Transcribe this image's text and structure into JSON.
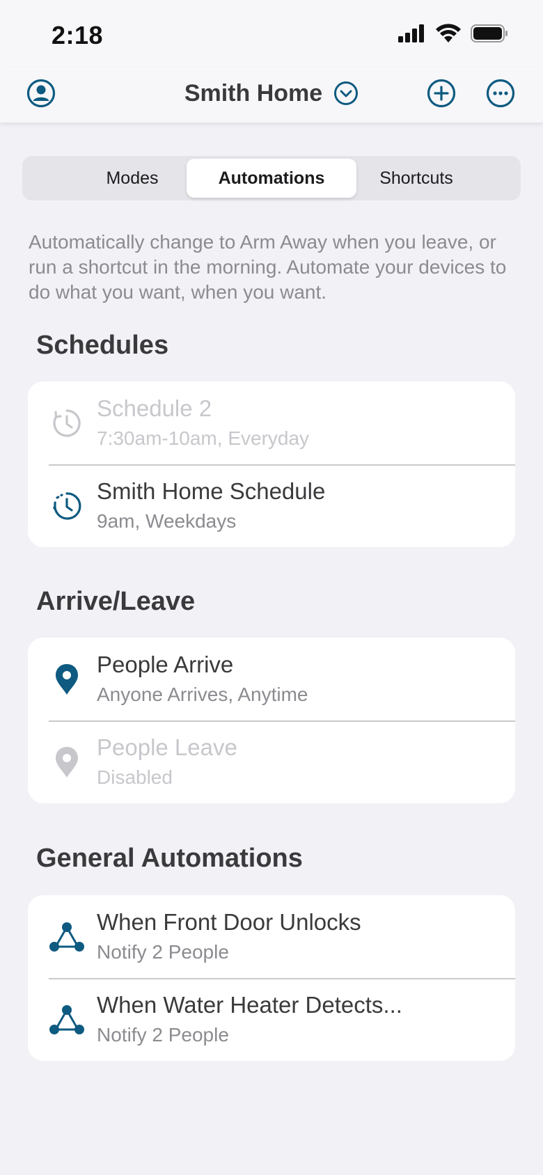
{
  "status_bar": {
    "time": "2:18"
  },
  "header": {
    "title": "Smith Home"
  },
  "tabs": [
    {
      "label": "Modes",
      "active": false
    },
    {
      "label": "Automations",
      "active": true
    },
    {
      "label": "Shortcuts",
      "active": false
    }
  ],
  "intro": "Automatically change to Arm Away when you leave, or run a shortcut in the morning. Automate your devices to do what you want, when you want.",
  "sections": {
    "schedules": {
      "title": "Schedules",
      "items": [
        {
          "title": "Schedule 2",
          "subtitle": "7:30am-10am, Everyday",
          "enabled": false,
          "icon": "clock-history-icon"
        },
        {
          "title": "Smith Home Schedule",
          "subtitle": "9am, Weekdays",
          "enabled": true,
          "icon": "clock-history-icon"
        }
      ]
    },
    "arrive_leave": {
      "title": "Arrive/Leave",
      "items": [
        {
          "title": "People Arrive",
          "subtitle": "Anyone Arrives, Anytime",
          "enabled": true,
          "icon": "location-pin-icon"
        },
        {
          "title": "People Leave",
          "subtitle": "Disabled",
          "enabled": false,
          "icon": "location-pin-icon"
        }
      ]
    },
    "general": {
      "title": "General Automations",
      "items": [
        {
          "title": "When Front Door Unlocks",
          "subtitle": "Notify 2 People",
          "enabled": true,
          "icon": "automation-nodes-icon"
        },
        {
          "title": "When Water Heater Detects...",
          "subtitle": "Notify 2 People",
          "enabled": true,
          "icon": "automation-nodes-icon"
        }
      ]
    }
  },
  "colors": {
    "accent": "#0e5a80",
    "disabled": "#c7c7cc",
    "background": "#f1f1f6"
  }
}
